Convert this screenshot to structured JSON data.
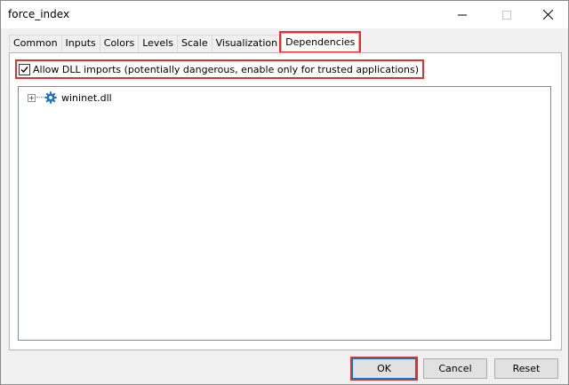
{
  "window": {
    "title": "force_index"
  },
  "tabs": [
    "Common",
    "Inputs",
    "Colors",
    "Levels",
    "Scale",
    "Visualization",
    "Dependencies"
  ],
  "active_tab": "Dependencies",
  "dependencies": {
    "allow_dll_label": "Allow DLL imports (potentially dangerous, enable only for trusted applications)",
    "allow_dll_checked": true,
    "tree": [
      {
        "label": "wininet.dll",
        "icon": "gear-icon",
        "expander": "+"
      }
    ]
  },
  "buttons": {
    "ok": "OK",
    "cancel": "Cancel",
    "reset": "Reset"
  },
  "colors": {
    "highlight": "#e03131",
    "accent": "#0078d7",
    "icon": "#1e73be"
  }
}
